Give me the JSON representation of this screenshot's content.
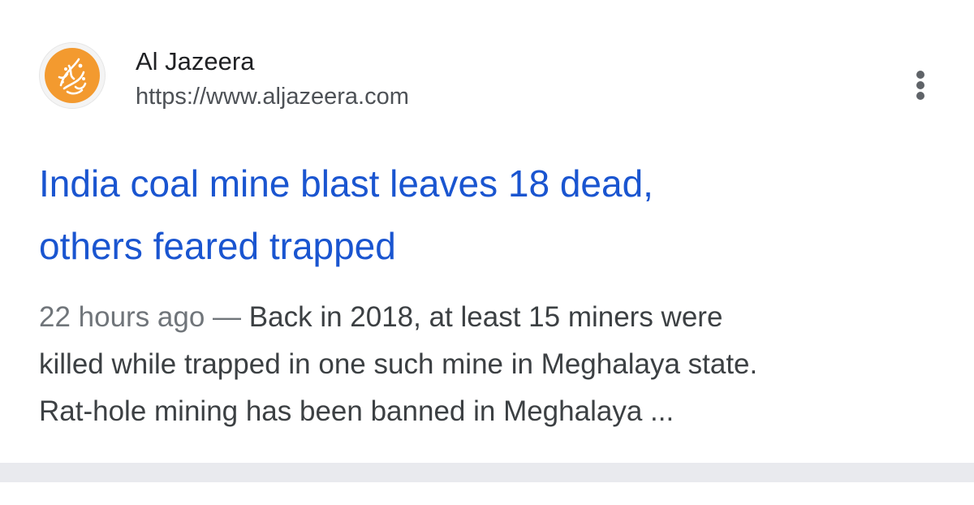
{
  "result": {
    "site_name": "Al Jazeera",
    "url": "https://www.aljazeera.com",
    "favicon": {
      "icon": "al-jazeera-logo-icon",
      "color": "#f39a2f"
    },
    "more_icon": "more-vert-icon",
    "title_line1": "India coal mine blast leaves 18 dead,",
    "title_line2": "others feared trapped",
    "title_color": "#1a55d0",
    "date": "22 hours ago",
    "dash": " — ",
    "snippet_line1": "Back in 2018, at least 15 miners were",
    "snippet_line2": "killed while trapped in one such mine in Meghalaya state.",
    "snippet_line3": "Rat-hole mining has been banned in Meghalaya ..."
  }
}
